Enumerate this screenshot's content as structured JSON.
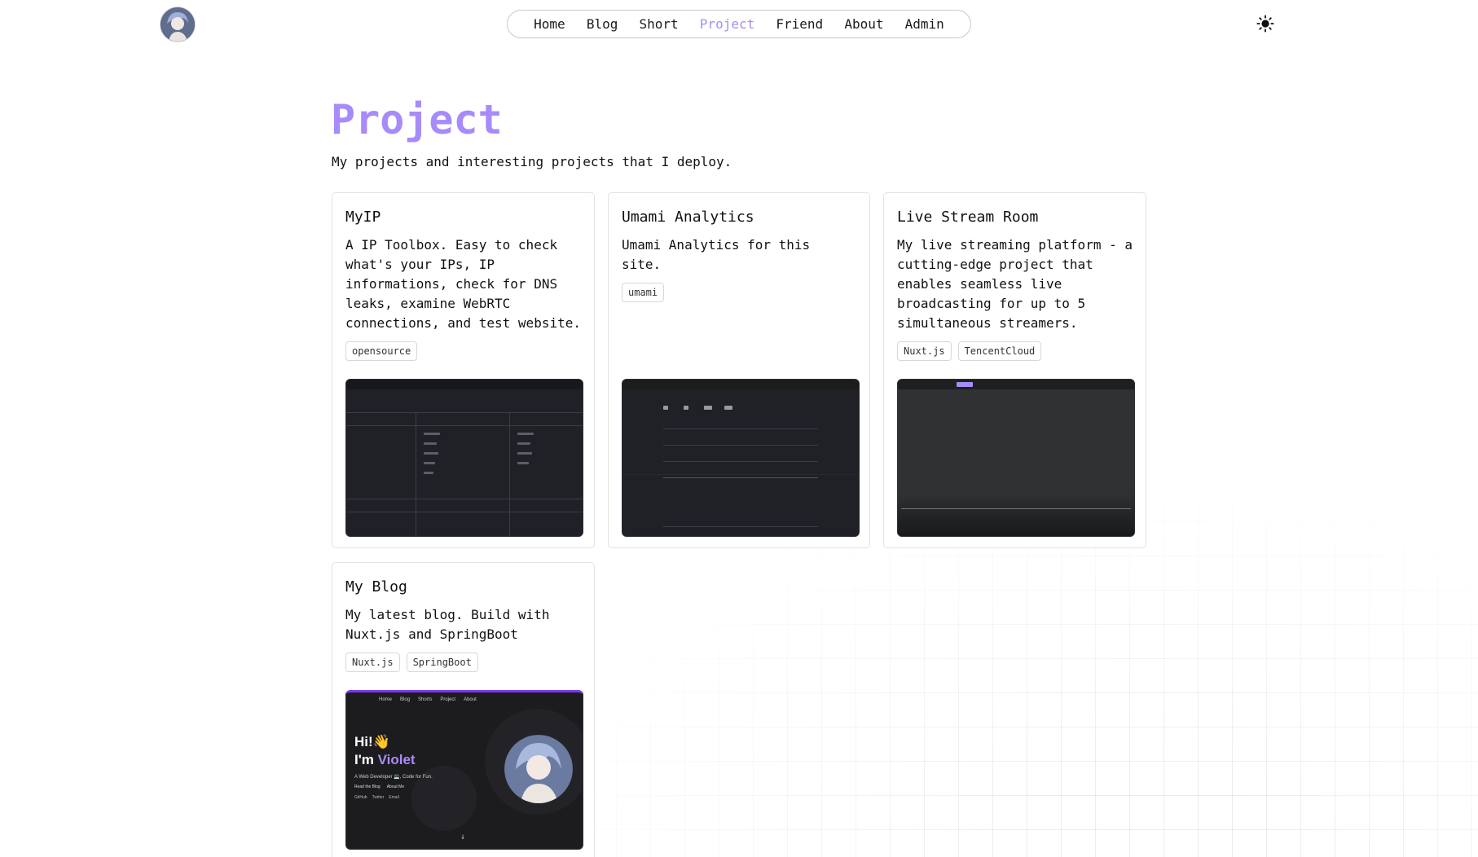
{
  "nav": {
    "items": [
      {
        "label": "Home"
      },
      {
        "label": "Blog"
      },
      {
        "label": "Short"
      },
      {
        "label": "Project"
      },
      {
        "label": "Friend"
      },
      {
        "label": "About"
      },
      {
        "label": "Admin"
      }
    ],
    "active": "Project"
  },
  "colors": {
    "accent": "#a78bfa",
    "text": "#111111",
    "card_border": "#e2e2e2",
    "thumb_dark": "#1f2127"
  },
  "page": {
    "title": "Project",
    "subtitle": "My projects and interesting projects that I deploy."
  },
  "projects": [
    {
      "title": "MyIP",
      "description": "A IP Toolbox. Easy to check what's your IPs, IP informations, check for DNS leaks, examine WebRTC connections, and test website.",
      "tags": [
        "opensource"
      ]
    },
    {
      "title": "Umami Analytics",
      "description": "Umami Analytics for this site.",
      "tags": [
        "umami"
      ]
    },
    {
      "title": "Live Stream Room",
      "description": "My live streaming platform - a cutting-edge project that enables seamless live broadcasting for up to 5 simultaneous streamers.",
      "tags": [
        "Nuxt.js",
        "TencentCloud"
      ]
    },
    {
      "title": "My Blog",
      "description": "My latest blog. Build with Nuxt.js and SpringBoot",
      "tags": [
        "Nuxt.js",
        "SpringBoot"
      ]
    }
  ],
  "blog_preview": {
    "nav": [
      "Home",
      "Blog",
      "Shorts",
      "Project",
      "About"
    ],
    "greeting": "Hi!👋",
    "im": "I'm ",
    "name": "Violet",
    "tagline": "A Web Developer 💻, Code for Fun.",
    "buttons": [
      "Read the Blog",
      "About Me"
    ],
    "links": [
      "GitHub",
      "Twitter",
      "Email"
    ]
  },
  "icons": {
    "avatar": "avatar-image",
    "theme": "sun-icon"
  }
}
